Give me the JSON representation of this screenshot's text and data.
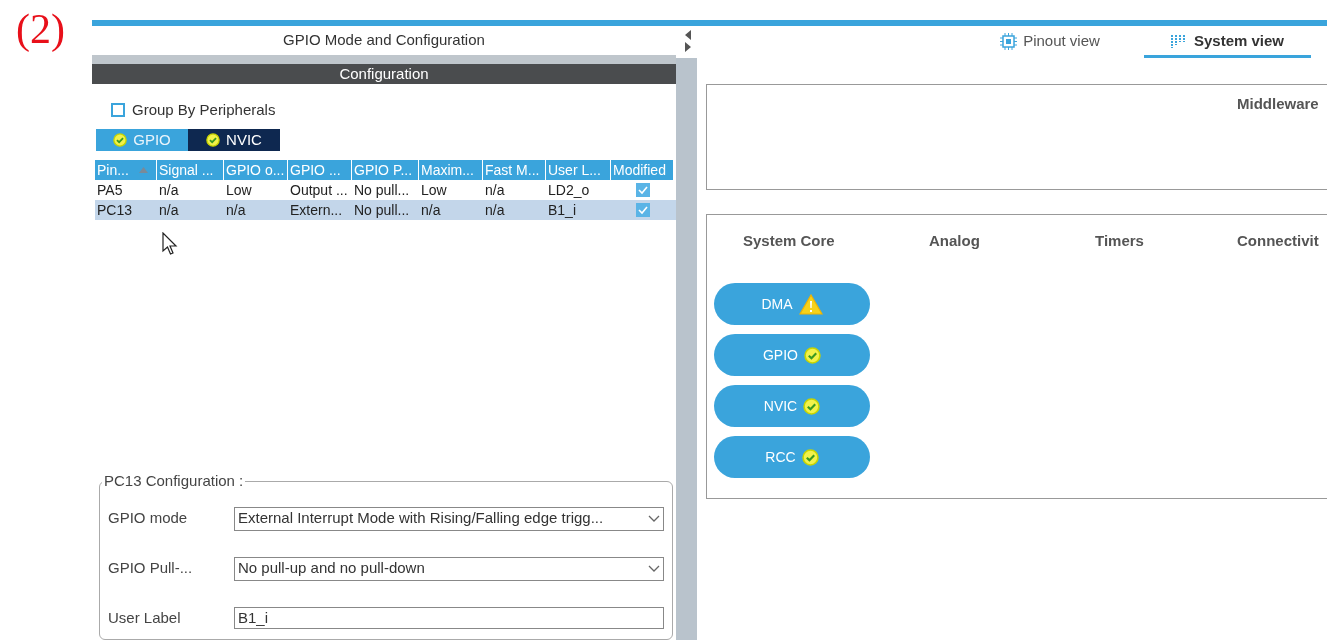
{
  "figure_label": "(2)",
  "left_panel": {
    "title": "GPIO Mode and Configuration",
    "section": "Configuration",
    "group_by_peripherals": {
      "label": "Group By Peripherals",
      "checked": false
    },
    "tabs": [
      {
        "label": "GPIO",
        "selected": true
      },
      {
        "label": "NVIC",
        "selected": false
      }
    ],
    "table": {
      "columns": [
        "Pin...",
        "Signal ...",
        "GPIO o...",
        "GPIO ...",
        "GPIO P...",
        "Maxim...",
        "Fast M...",
        "User L...",
        "Modified"
      ],
      "rows": [
        {
          "cells": [
            "PA5",
            "n/a",
            "Low",
            "Output ...",
            "No pull...",
            "Low",
            "n/a",
            "LD2_o"
          ],
          "modified": true,
          "selected": false
        },
        {
          "cells": [
            "PC13",
            "n/a",
            "n/a",
            "Extern...",
            "No pull...",
            "n/a",
            "n/a",
            "B1_i"
          ],
          "modified": true,
          "selected": true
        }
      ]
    },
    "pin_config": {
      "title": "PC13 Configuration :",
      "fields": [
        {
          "label": "GPIO mode",
          "kind": "select",
          "value": "External Interrupt Mode with Rising/Falling edge trigg..."
        },
        {
          "label": "GPIO Pull-...",
          "kind": "select",
          "value": "No pull-up and no pull-down"
        },
        {
          "label": "User Label",
          "kind": "text",
          "value": "B1_i"
        }
      ]
    }
  },
  "right_panel": {
    "tabs": [
      {
        "label": "Pinout view",
        "selected": false
      },
      {
        "label": "System view",
        "selected": true
      }
    ],
    "middleware": {
      "title": "Middleware"
    },
    "categories": [
      "System Core",
      "Analog",
      "Timers",
      "Connectivit"
    ],
    "system_core_buttons": [
      {
        "label": "DMA",
        "kind": "warning"
      },
      {
        "label": "GPIO",
        "kind": "ok"
      },
      {
        "label": "NVIC",
        "kind": "ok"
      },
      {
        "label": "RCC",
        "kind": "ok"
      }
    ]
  }
}
